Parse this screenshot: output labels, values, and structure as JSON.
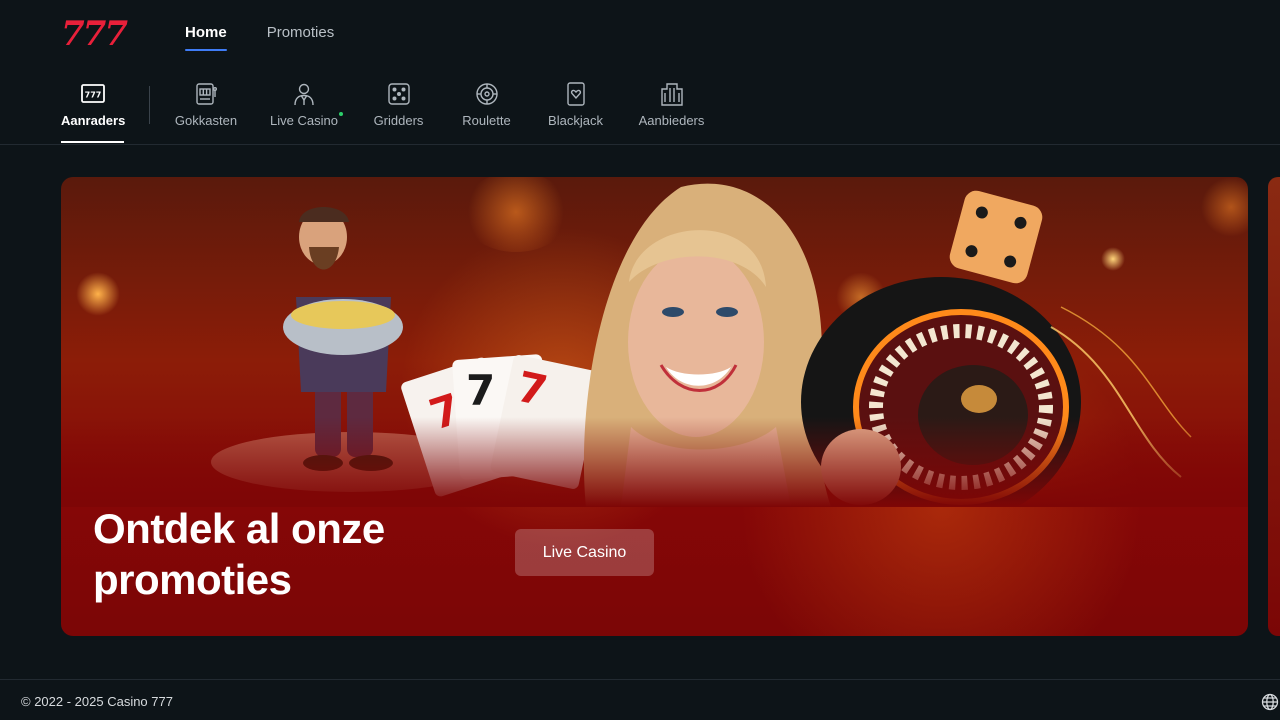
{
  "header": {
    "logo": "777",
    "nav": [
      {
        "label": "Home",
        "active": true
      },
      {
        "label": "Promoties",
        "active": false
      }
    ]
  },
  "categories": [
    {
      "label": "Aanraders",
      "icon": "777-badge-icon",
      "active": true
    },
    {
      "label": "Gokkasten",
      "icon": "slot-machine-icon",
      "active": false
    },
    {
      "label": "Live Casino",
      "icon": "dealer-icon",
      "active": false,
      "live_indicator": true
    },
    {
      "label": "Gridders",
      "icon": "dice-icon",
      "active": false
    },
    {
      "label": "Roulette",
      "icon": "roulette-icon",
      "active": false
    },
    {
      "label": "Blackjack",
      "icon": "playing-card-icon",
      "active": false
    },
    {
      "label": "Aanbieders",
      "icon": "building-icon",
      "active": false
    }
  ],
  "banner": {
    "title": "Ontdek al onze promoties",
    "cta_label": "Live Casino"
  },
  "footer": {
    "copyright": "© 2022 - 2025 Casino 777",
    "language_icon": "globe-icon"
  },
  "colors": {
    "background": "#0d1418",
    "logo": "#e8203a",
    "nav_underline": "#3f7cf5",
    "banner": "#7e0606",
    "live_dot": "#2ccf6a"
  }
}
